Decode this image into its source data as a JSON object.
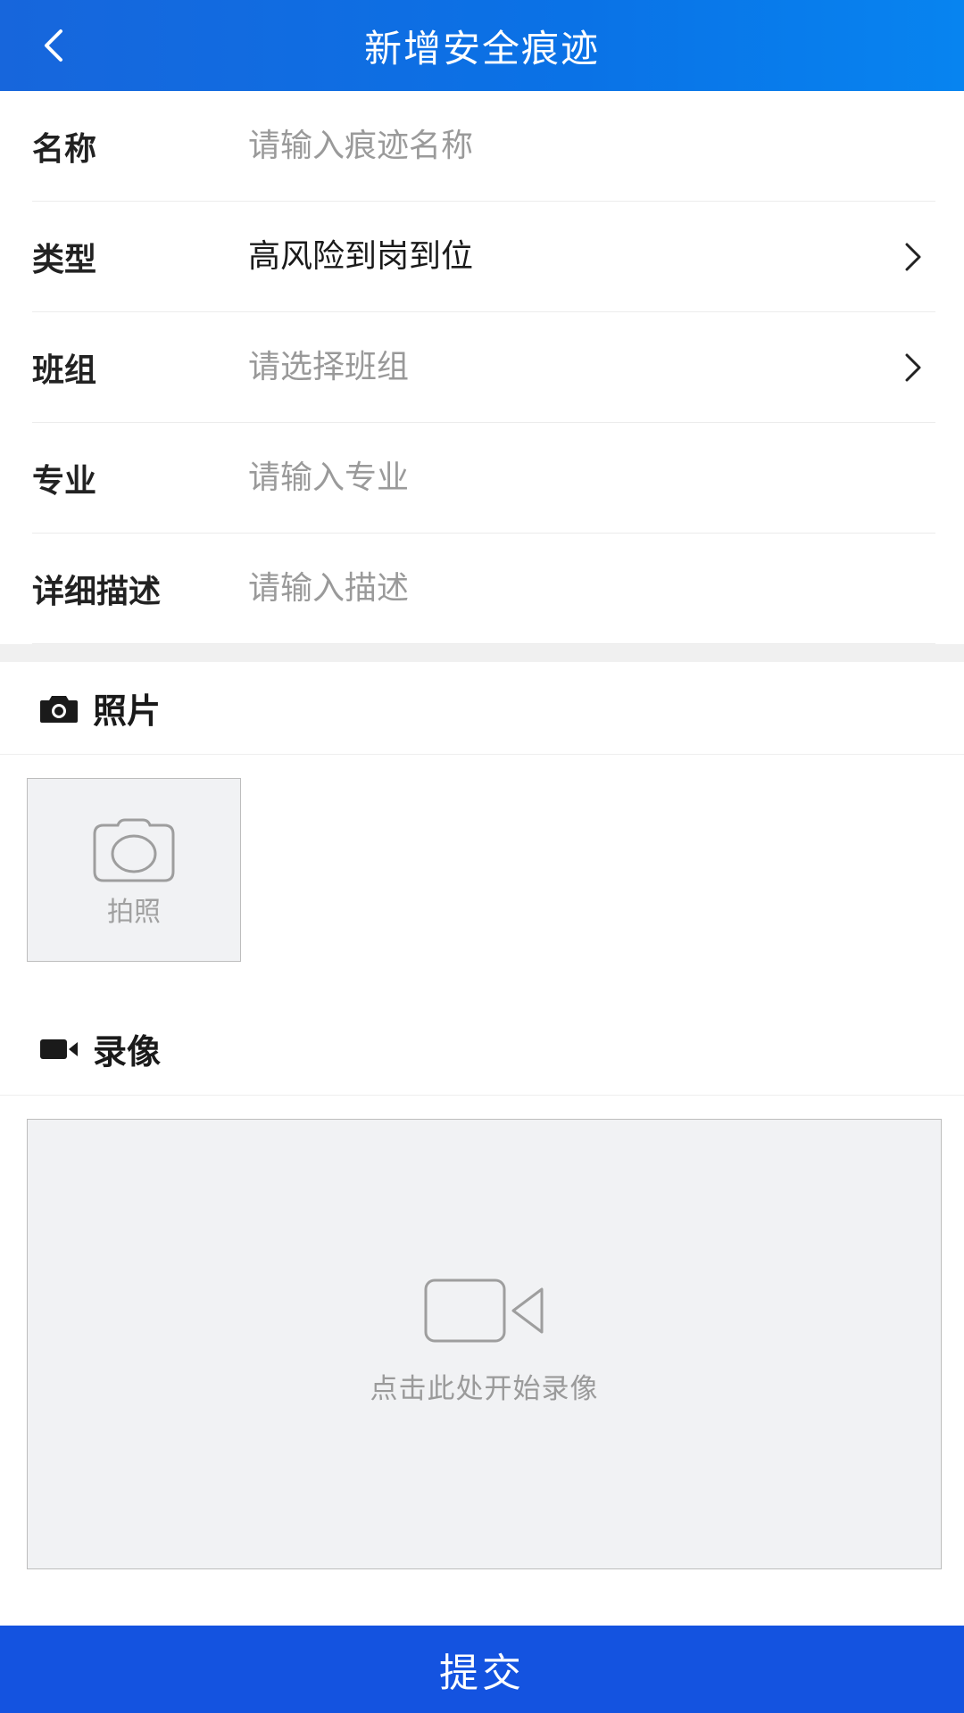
{
  "header": {
    "title": "新增安全痕迹",
    "back_icon": "chevron-left-icon"
  },
  "form": {
    "name": {
      "label": "名称",
      "placeholder": "请输入痕迹名称",
      "value": ""
    },
    "type": {
      "label": "类型",
      "value": "高风险到岗到位"
    },
    "team": {
      "label": "班组",
      "placeholder": "请选择班组"
    },
    "major": {
      "label": "专业",
      "placeholder": "请输入专业",
      "value": ""
    },
    "description": {
      "label": "详细描述",
      "placeholder": "请输入描述",
      "value": ""
    }
  },
  "photo_section": {
    "title": "照片",
    "icon": "camera-icon",
    "take_photo_label": "拍照"
  },
  "video_section": {
    "title": "录像",
    "icon": "video-camera-icon",
    "hint": "点击此处开始录像"
  },
  "submit_label": "提交",
  "colors": {
    "header_start": "#1766dc",
    "header_end": "#0784f0",
    "submit_bg": "#1453e0",
    "placeholder": "#999999"
  }
}
